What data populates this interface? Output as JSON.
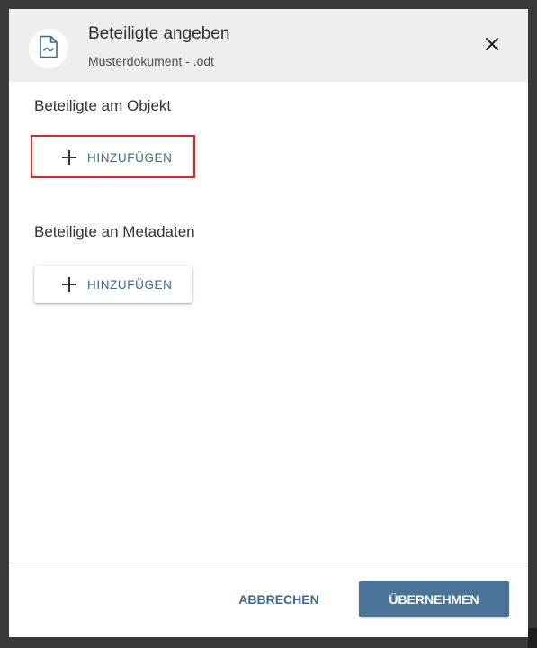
{
  "header": {
    "title": "Beteiligte angeben",
    "subtitle": "Musterdokument - .odt",
    "icon": "document-icon",
    "close_icon": "close-icon"
  },
  "sections": [
    {
      "title": "Beteiligte am Objekt",
      "add_label": "HINZUFÜGEN",
      "highlighted": true
    },
    {
      "title": "Beteiligte an Metadaten",
      "add_label": "HINZUFÜGEN",
      "highlighted": false
    }
  ],
  "footer": {
    "cancel_label": "ABBRECHEN",
    "apply_label": "ÜBERNEHMEN"
  },
  "colors": {
    "accent": "#4a7397",
    "link_text": "#3d6a8a",
    "highlight": "#d42a2a",
    "header_bg": "#eeeeee"
  }
}
